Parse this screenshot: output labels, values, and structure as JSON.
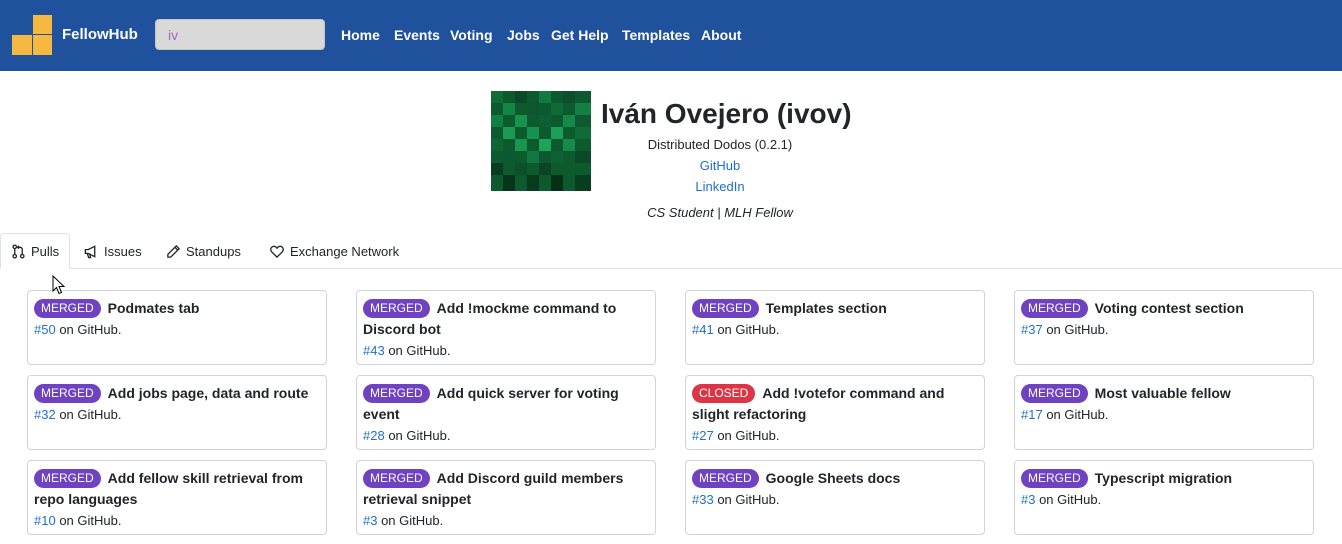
{
  "navbar": {
    "brand": "FellowHub",
    "search_value": "iv",
    "links": [
      "Home",
      "Events",
      "Voting",
      "Jobs",
      "Get Help",
      "Templates",
      "About"
    ]
  },
  "profile": {
    "name": "Iván Ovejero (ivov)",
    "project": "Distributed Dodos (0.2.1)",
    "github_label": "GitHub",
    "linkedin_label": "LinkedIn",
    "bio": "CS Student | MLH Fellow"
  },
  "tabs": [
    {
      "label": "Pulls",
      "icon": "pull-request-icon",
      "active": true
    },
    {
      "label": "Issues",
      "icon": "megaphone-icon",
      "active": false
    },
    {
      "label": "Standups",
      "icon": "pencil-icon",
      "active": false
    },
    {
      "label": "Exchange Network",
      "icon": "heart-icon",
      "active": false
    }
  ],
  "pulls": [
    {
      "status": "MERGED",
      "title": "Podmates tab",
      "number": "#50",
      "suffix": " on GitHub."
    },
    {
      "status": "MERGED",
      "title": "Add !mockme command to Discord bot",
      "number": "#43",
      "suffix": " on GitHub."
    },
    {
      "status": "MERGED",
      "title": "Templates section",
      "number": "#41",
      "suffix": " on GitHub."
    },
    {
      "status": "MERGED",
      "title": "Voting contest section",
      "number": "#37",
      "suffix": " on GitHub."
    },
    {
      "status": "MERGED",
      "title": "Add jobs page, data and route",
      "number": "#32",
      "suffix": " on GitHub."
    },
    {
      "status": "MERGED",
      "title": "Add quick server for voting event",
      "number": "#28",
      "suffix": " on GitHub."
    },
    {
      "status": "CLOSED",
      "title": "Add !votefor command and slight refactoring",
      "number": "#27",
      "suffix": " on GitHub."
    },
    {
      "status": "MERGED",
      "title": "Most valuable fellow",
      "number": "#17",
      "suffix": " on GitHub."
    },
    {
      "status": "MERGED",
      "title": "Add fellow skill retrieval from repo languages",
      "number": "#10",
      "suffix": " on GitHub."
    },
    {
      "status": "MERGED",
      "title": "Add Discord guild members retrieval snippet",
      "number": "#3",
      "suffix": " on GitHub."
    },
    {
      "status": "MERGED",
      "title": "Google Sheets docs",
      "number": "#33",
      "suffix": " on GitHub."
    },
    {
      "status": "MERGED",
      "title": "Typescript migration",
      "number": "#3",
      "suffix": " on GitHub."
    }
  ],
  "colors": {
    "navbar": "#1f519c",
    "brand_logo": "#f5b942",
    "merged": "#6f42c1",
    "closed": "#dc3545",
    "link": "#1f6fd0"
  }
}
